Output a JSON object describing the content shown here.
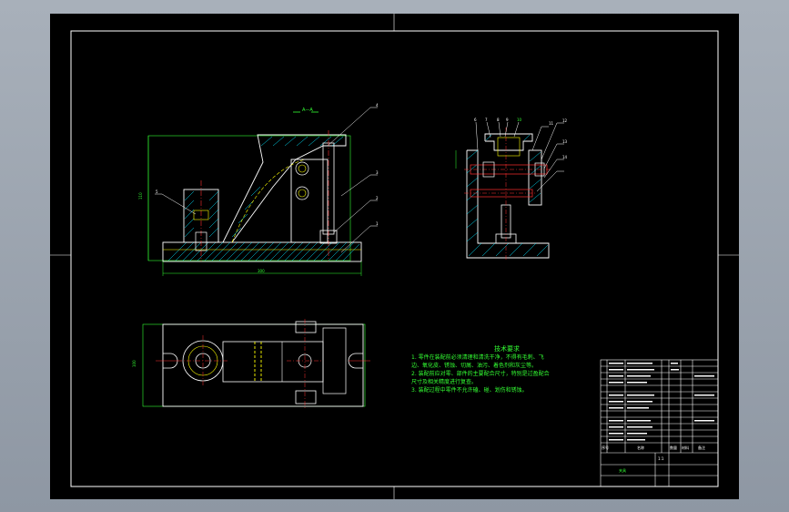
{
  "drawing": {
    "section_label": "A—A",
    "dims": {
      "overall_width": "300",
      "height": "110",
      "plan_height": "100"
    },
    "callouts_front": [
      "4",
      "3",
      "2",
      "1",
      "5"
    ],
    "callouts_side": [
      "6",
      "7",
      "8",
      "9",
      "10",
      "11",
      "12",
      "13",
      "14"
    ],
    "colors": {
      "outline": "#ffffff",
      "hatch": "#00e5ff",
      "green": "#33ff33",
      "yellow": "#ffff00",
      "red": "#ff3030",
      "cyan": "#00ffff",
      "title_block": "#ffffff",
      "background": "#000000"
    }
  },
  "tech_notes": {
    "title": "技术要求",
    "lines": [
      "1. 零件在装配前必须清理和清洗干净，不得有毛刺、飞",
      "边、氧化皮、锈蚀、切屑、油污、着色剂和灰尘等。",
      "2. 装配前应对零、部件的主要配合尺寸，特别是过盈配合",
      "尺寸及相关精度进行复查。",
      "3. 装配过程中零件不允许磕、碰、划伤和锈蚀。"
    ]
  },
  "title_block": {
    "header_seq": "序号",
    "header_name": "名称",
    "header_qty": "数量",
    "header_material": "材料",
    "header_note": "备注",
    "drawing_name": "夹具",
    "scale": "1:1"
  }
}
